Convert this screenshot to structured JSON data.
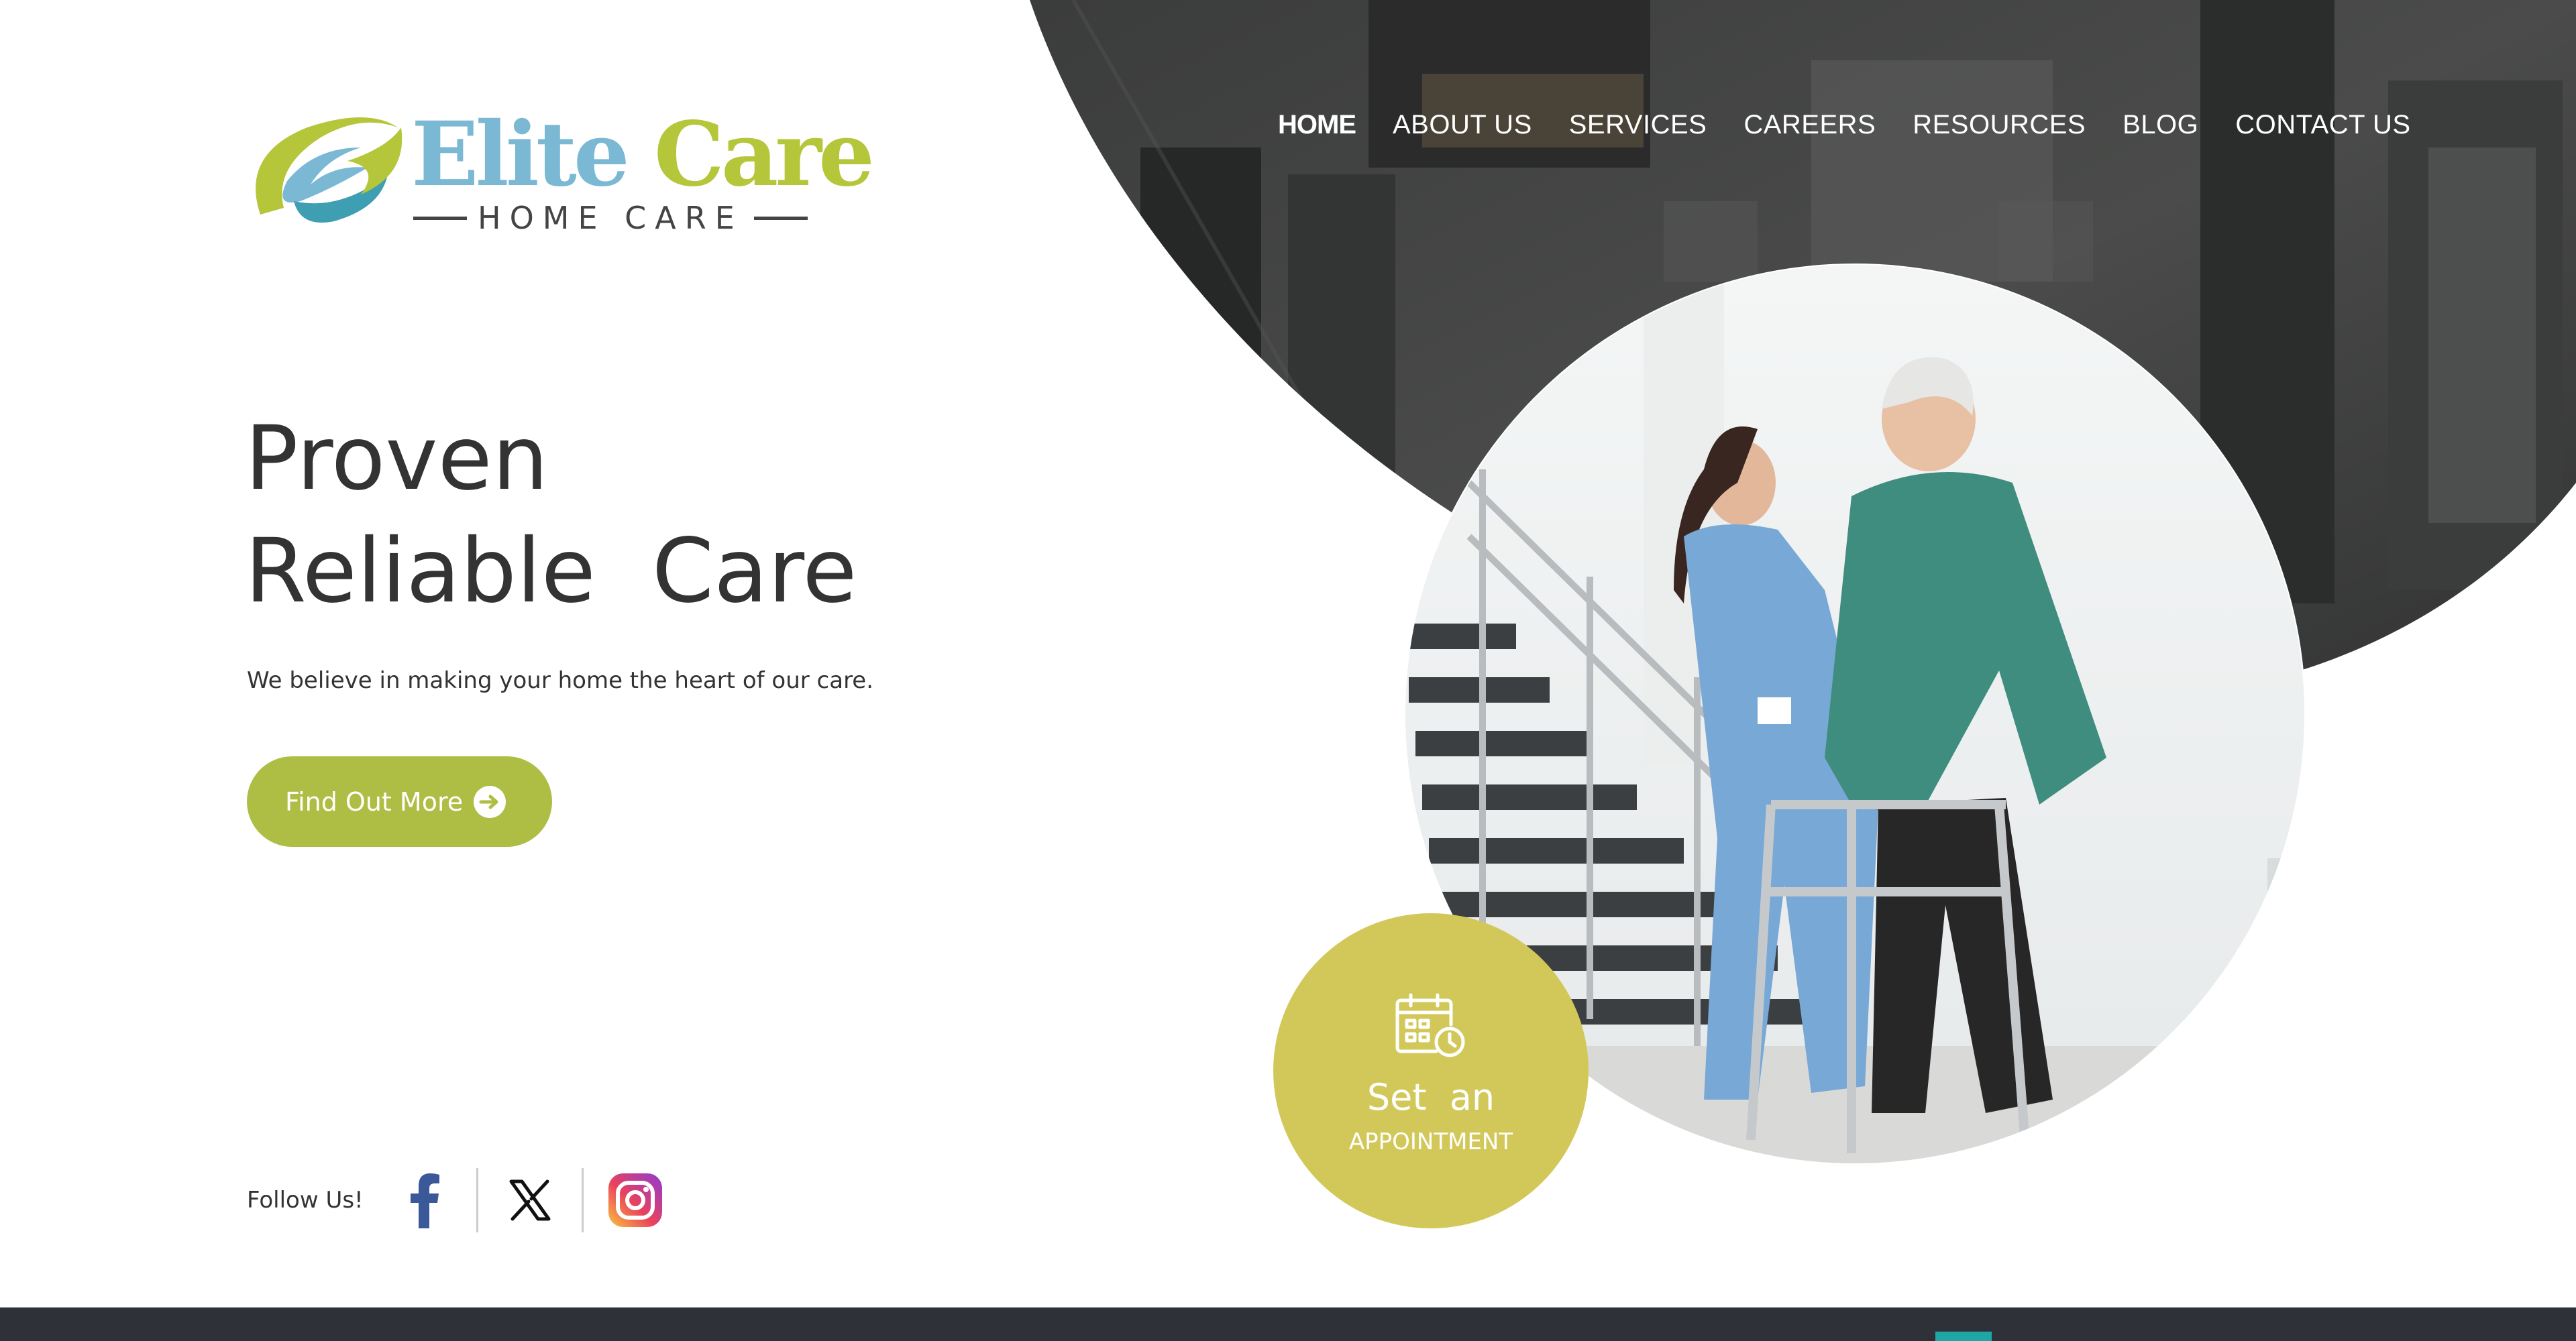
{
  "brand": {
    "name_part1": "Elite",
    "name_part2": "Care",
    "tagline": "HOME CARE",
    "colors": {
      "blue": "#7ab8d4",
      "green": "#b6c63a",
      "teal": "#3f9fb2"
    },
    "icon": "elite-care-logo-mark"
  },
  "nav": {
    "items": [
      {
        "label": "HOME",
        "active": true
      },
      {
        "label": "ABOUT US"
      },
      {
        "label": "SERVICES"
      },
      {
        "label": "CAREERS"
      },
      {
        "label": "RESOURCES"
      },
      {
        "label": "BLOG"
      },
      {
        "label": "CONTACT US"
      }
    ]
  },
  "hero": {
    "title_line1": "Proven",
    "title_line2": "Reliable  Care",
    "subtitle": "We believe in making your home the heart of our care.",
    "cta_label": "Find Out More",
    "cta_icon": "arrow-circle-right-icon",
    "accent_color": "#aebe45"
  },
  "social": {
    "label": "Follow Us!",
    "links": [
      {
        "name": "facebook",
        "icon": "facebook-icon",
        "color": "#3b5998"
      },
      {
        "name": "x",
        "icon": "x-icon",
        "color": "#000000"
      },
      {
        "name": "instagram",
        "icon": "instagram-icon",
        "color": "#e1306c"
      }
    ]
  },
  "appointment": {
    "line1": "Set  an",
    "line2": "APPOINTMENT",
    "icon": "calendar-clock-icon",
    "color": "#d2c85a"
  },
  "footer": {
    "bar_color": "#2f3139",
    "accent_color": "#1ea7a5"
  }
}
